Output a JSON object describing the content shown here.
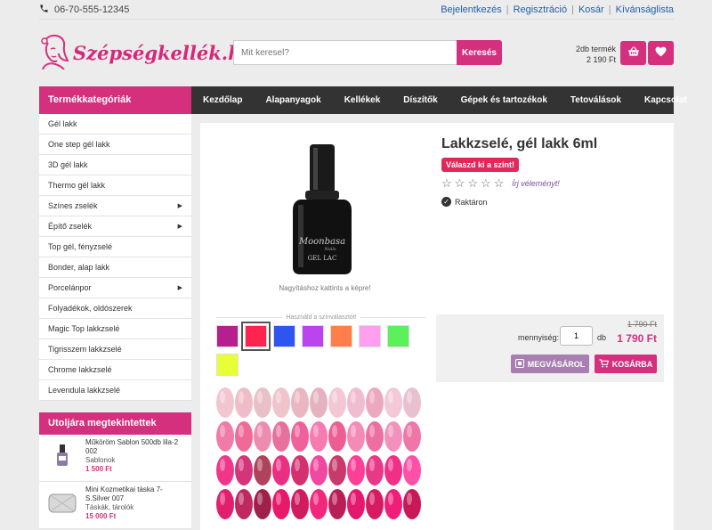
{
  "topbar": {
    "phone": "06-70-555-12345",
    "links": [
      "Bejelentkezés",
      "Regisztráció",
      "Kosár",
      "Kívánságlista"
    ]
  },
  "header": {
    "logo_text": "Szépségkellék.hu",
    "search_placeholder": "Mit keresel?",
    "search_button": "Keresés",
    "cart_count": "2db termék",
    "cart_total": "2 190 Ft",
    "cart_icon": "basket-icon",
    "wishlist_icon": "heart-icon"
  },
  "category_title": "Termékkategóriák",
  "nav": [
    "Kezdőlap",
    "Alapanyagok",
    "Kellékek",
    "Díszítők",
    "Gépek és tartozékok",
    "Tetoválások",
    "Kapcsolat"
  ],
  "categories": [
    {
      "label": "Gél lakk",
      "sub": false
    },
    {
      "label": "One step gél lakk",
      "sub": false
    },
    {
      "label": "3D gél lakk",
      "sub": false
    },
    {
      "label": "Thermo gél lakk",
      "sub": false
    },
    {
      "label": "Színes zselék",
      "sub": true
    },
    {
      "label": "Építő zselék",
      "sub": true
    },
    {
      "label": "Top gél, fényzselé",
      "sub": false
    },
    {
      "label": "Bonder, alap lakk",
      "sub": false
    },
    {
      "label": "Porcelánpor",
      "sub": true
    },
    {
      "label": "Folyadékok, oldószerek",
      "sub": false
    },
    {
      "label": "Magic Top lakkzselé",
      "sub": false
    },
    {
      "label": "Tigrisszem lakkzselé",
      "sub": false
    },
    {
      "label": "Chrome lakkzselé",
      "sub": false
    },
    {
      "label": "Levendula lakkzselé",
      "sub": false
    }
  ],
  "recent": {
    "title": "Utoljára megtekintettek",
    "items": [
      {
        "name": "Műköröm Sablon 500db lila-2 002",
        "category": "Sablonok",
        "price": "1 500 Ft"
      },
      {
        "name": "Mini Kozmetikai táska 7-S.Silver 007",
        "category": "Táskák, tárolók",
        "price": "15 000 Ft"
      }
    ]
  },
  "product": {
    "title": "Lakkzselé, gél lakk 6ml",
    "pick_badge": "Válaszd ki a szint!",
    "review_link": "Írj véleményt!",
    "stock": "Raktáron",
    "zoom_hint": "Nagyításhoz kattints a képre!",
    "bottle_brand": "Moonbasa",
    "bottle_sub": "Nails",
    "bottle_label": "GEL LAC",
    "swatch_label": "Használd a színválasztót!",
    "swatches": [
      "#b51f8e",
      "#ff2350",
      "#2f55f0",
      "#bb44ee",
      "#ff7f4a",
      "#ff9ff0",
      "#5cf05c",
      "#e8ff38"
    ],
    "selected_swatch": 1,
    "old_price": "1 790 Ft",
    "price": "1 790 Ft",
    "qty_label": "mennyiség:",
    "qty_value": "1",
    "qty_unit": "db",
    "buy_button": "MEGVÁSÁROL",
    "cart_button": "KOSÁRBA"
  },
  "colors": {
    "accent": "#d4307e",
    "nav_bg": "#333333",
    "buy_button": "#a77fb0"
  }
}
